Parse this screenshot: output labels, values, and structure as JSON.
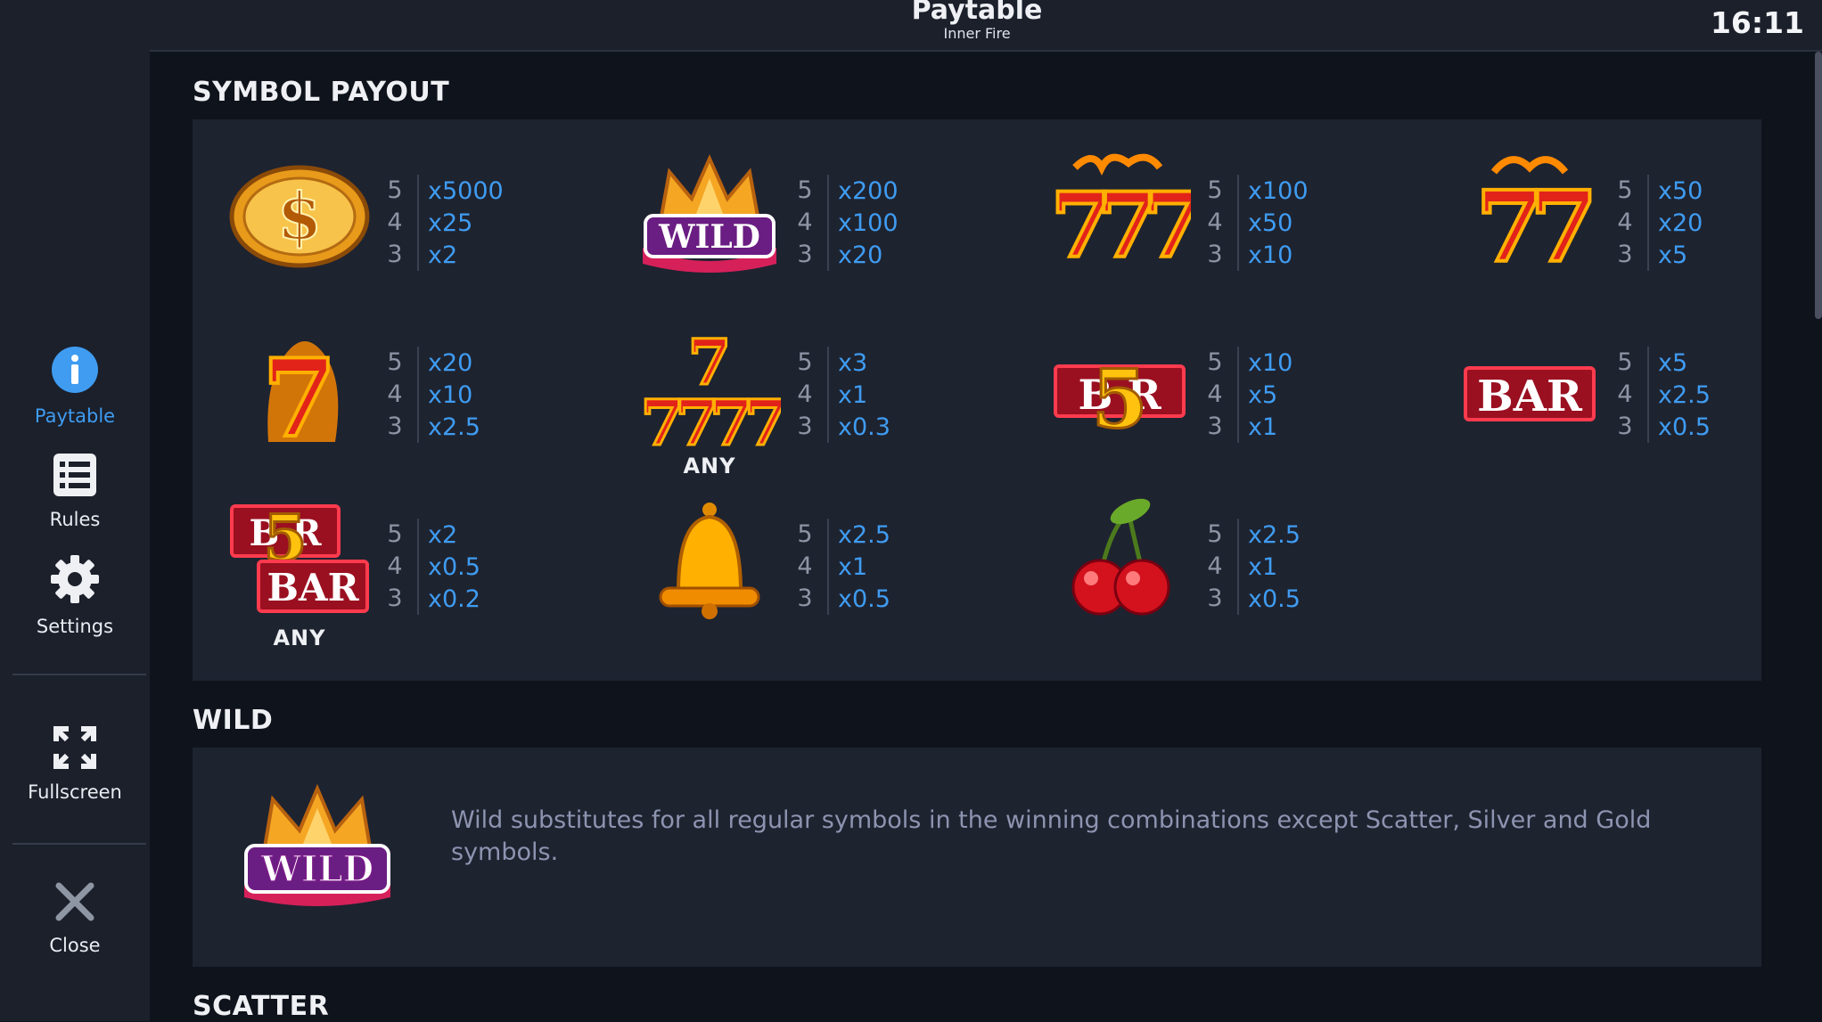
{
  "header": {
    "title": "Paytable",
    "subtitle": "Inner Fire",
    "time": "16:11"
  },
  "sidebar": {
    "items": [
      {
        "label": "Paytable",
        "icon": "info-icon",
        "active": true
      },
      {
        "label": "Rules",
        "icon": "list-icon"
      },
      {
        "label": "Settings",
        "icon": "gear-icon"
      },
      {
        "label": "Fullscreen",
        "icon": "fullscreen-icon"
      },
      {
        "label": "Close",
        "icon": "close-icon"
      }
    ]
  },
  "symbol_payout": {
    "title": "SYMBOL PAYOUT",
    "symbols": [
      {
        "name": "dollar-coin",
        "any": "",
        "pays": [
          {
            "count": "5",
            "value": "x5000"
          },
          {
            "count": "4",
            "value": "x25"
          },
          {
            "count": "3",
            "value": "x2"
          }
        ]
      },
      {
        "name": "wild-crown",
        "any": "",
        "pays": [
          {
            "count": "5",
            "value": "x200"
          },
          {
            "count": "4",
            "value": "x100"
          },
          {
            "count": "3",
            "value": "x20"
          }
        ]
      },
      {
        "name": "triple-seven",
        "any": "",
        "pays": [
          {
            "count": "5",
            "value": "x100"
          },
          {
            "count": "4",
            "value": "x50"
          },
          {
            "count": "3",
            "value": "x10"
          }
        ]
      },
      {
        "name": "double-seven",
        "any": "",
        "pays": [
          {
            "count": "5",
            "value": "x50"
          },
          {
            "count": "4",
            "value": "x20"
          },
          {
            "count": "3",
            "value": "x5"
          }
        ]
      },
      {
        "name": "single-seven",
        "any": "",
        "pays": [
          {
            "count": "5",
            "value": "x20"
          },
          {
            "count": "4",
            "value": "x10"
          },
          {
            "count": "3",
            "value": "x2.5"
          }
        ]
      },
      {
        "name": "any-seven",
        "any": "ANY",
        "pays": [
          {
            "count": "5",
            "value": "x3"
          },
          {
            "count": "4",
            "value": "x1"
          },
          {
            "count": "3",
            "value": "x0.3"
          }
        ]
      },
      {
        "name": "five-bar",
        "any": "",
        "pays": [
          {
            "count": "5",
            "value": "x10"
          },
          {
            "count": "4",
            "value": "x5"
          },
          {
            "count": "3",
            "value": "x1"
          }
        ]
      },
      {
        "name": "bar",
        "any": "",
        "pays": [
          {
            "count": "5",
            "value": "x5"
          },
          {
            "count": "4",
            "value": "x2.5"
          },
          {
            "count": "3",
            "value": "x0.5"
          }
        ]
      },
      {
        "name": "any-bar",
        "any": "ANY",
        "pays": [
          {
            "count": "5",
            "value": "x2"
          },
          {
            "count": "4",
            "value": "x0.5"
          },
          {
            "count": "3",
            "value": "x0.2"
          }
        ]
      },
      {
        "name": "bell",
        "any": "",
        "pays": [
          {
            "count": "5",
            "value": "x2.5"
          },
          {
            "count": "4",
            "value": "x1"
          },
          {
            "count": "3",
            "value": "x0.5"
          }
        ]
      },
      {
        "name": "cherry",
        "any": "",
        "pays": [
          {
            "count": "5",
            "value": "x2.5"
          },
          {
            "count": "4",
            "value": "x1"
          },
          {
            "count": "3",
            "value": "x0.5"
          }
        ]
      }
    ]
  },
  "wild": {
    "title": "WILD",
    "description": "Wild substitutes for all regular symbols in the winning combinations except Scatter, Silver and Gold symbols."
  },
  "scatter": {
    "title": "SCATTER"
  },
  "colors": {
    "accent": "#3f9cf1",
    "panel": "#1e2330",
    "background": "#0f131b",
    "sidebar": "#1b202b"
  }
}
